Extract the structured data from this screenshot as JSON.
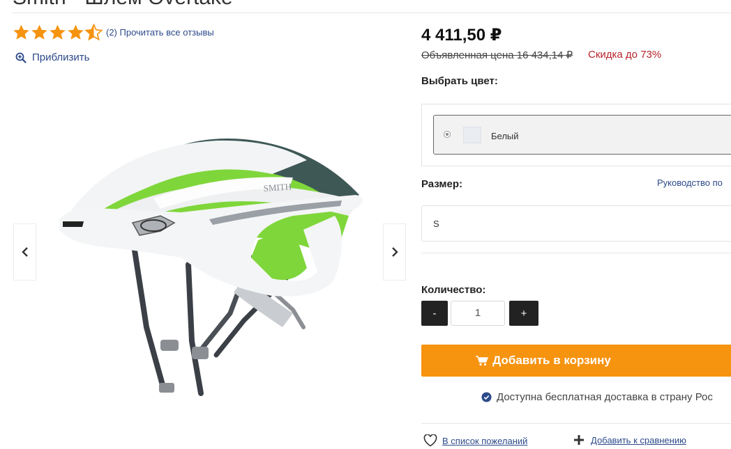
{
  "product": {
    "title": "Smith - Шлем Overtake",
    "rating_stars": 4.5,
    "reviews_link": "(2) Прочитать все отзывы",
    "zoom_label": "Приблизить",
    "brand_on_helmet": "SMITH"
  },
  "pricing": {
    "price": "4 411,50 ₽",
    "old_price": "Объявленная цена 16 434,14 ₽",
    "discount": "Скидка до 73%"
  },
  "color": {
    "label": "Выбрать цвет:",
    "selected": "Белый"
  },
  "size": {
    "label": "Размер:",
    "guide_link": "Руководство по",
    "selected": "S"
  },
  "quantity": {
    "label": "Количество:",
    "minus": "-",
    "value": "1",
    "plus": "+"
  },
  "cart": {
    "label": "Добавить в корзину"
  },
  "shipping": {
    "text": "Доступна бесплатная доставка в страну Рос"
  },
  "actions": {
    "wishlist": "В список пожеланий",
    "compare": "Добавить к сравнению"
  },
  "colors": {
    "accent": "#f6930f",
    "link": "#2c4a8a",
    "discount": "#b8232a",
    "star": "#f6930f"
  }
}
